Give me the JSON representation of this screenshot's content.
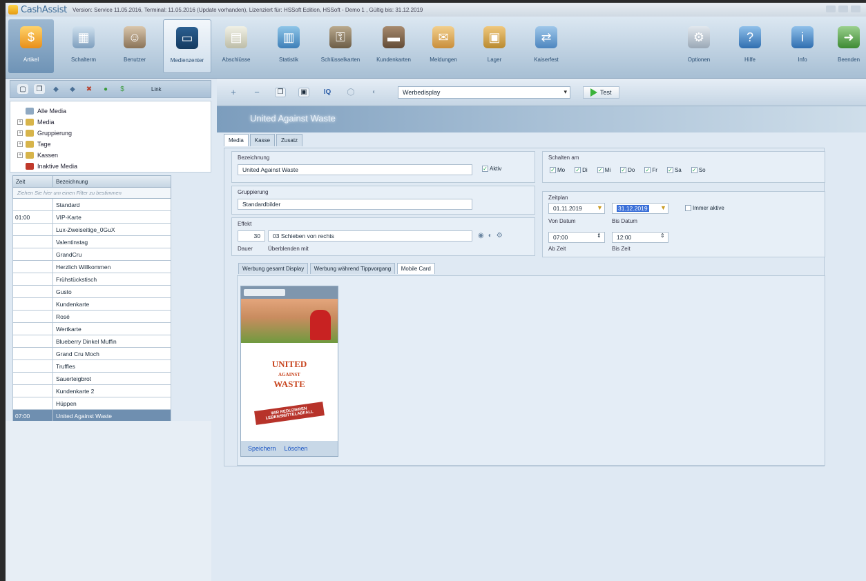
{
  "titlebar": {
    "brand": "CashAssist",
    "version_text": "Version: Service 11.05.2016, Terminal: 11.05.2016 (Update vorhanden), Lizenziert für: HSSoft Edition, HSSoft - Demo 1 , Gültig bis: 31.12.2019"
  },
  "ribbon": {
    "left": [
      {
        "label": "Artikel"
      },
      {
        "label": "Schalterm"
      },
      {
        "label": "Benutzer"
      },
      {
        "label": "Medienzenter"
      }
    ],
    "middle": [
      {
        "label": "Abschlüsse"
      },
      {
        "label": "Statistik"
      },
      {
        "label": "Schlüsselkarten"
      },
      {
        "label": "Kundenkarten"
      },
      {
        "label": "Meldungen"
      },
      {
        "label": "Lager"
      },
      {
        "label": "Kaiserfest"
      }
    ],
    "right": [
      {
        "label": "Optionen"
      },
      {
        "label": "Hilfe"
      },
      {
        "label": "Info"
      },
      {
        "label": "Beenden"
      }
    ]
  },
  "lefttoolbar": {
    "add_label": "Link"
  },
  "tree": [
    {
      "label": "Alle Media",
      "expand": ""
    },
    {
      "label": "Media",
      "expand": "+"
    },
    {
      "label": "Gruppierung",
      "expand": "+"
    },
    {
      "label": "Tage",
      "expand": "+"
    },
    {
      "label": "Kassen",
      "expand": "+"
    },
    {
      "label": "Inaktive Media",
      "expand": ""
    }
  ],
  "grid": {
    "col_time": "Zeit",
    "col_name": "Bezeichnung",
    "filter_placeholder": "Ziehen Sie hier um einen Filter zu bestimmen",
    "rows": [
      {
        "time": "",
        "name": "Standard"
      },
      {
        "time": "01:00",
        "name": "VIP-Karte"
      },
      {
        "time": "",
        "name": "Lux-Zweiseitige_0GuX"
      },
      {
        "time": "",
        "name": "Valentinstag"
      },
      {
        "time": "",
        "name": "GrandCru"
      },
      {
        "time": "",
        "name": "Herzlich Willkommen"
      },
      {
        "time": "",
        "name": "Frühstückstisch"
      },
      {
        "time": "",
        "name": "Gusto"
      },
      {
        "time": "",
        "name": "Kundenkarte"
      },
      {
        "time": "",
        "name": "Rosé"
      },
      {
        "time": "",
        "name": "Wertkarte"
      },
      {
        "time": "",
        "name": "Blueberry Dinkel Muffin"
      },
      {
        "time": "",
        "name": "Grand Cru Moch"
      },
      {
        "time": "",
        "name": "Truffles"
      },
      {
        "time": "",
        "name": "Sauerteigbrot"
      },
      {
        "time": "",
        "name": "Kundenkarte 2"
      },
      {
        "time": "",
        "name": "Hüppen"
      },
      {
        "time": "07:00",
        "name": "United Against Waste"
      }
    ]
  },
  "toolbar": {
    "select_value": "Werbedisplay",
    "test_label": "Test"
  },
  "header": {
    "title": "United Against Waste"
  },
  "tabs": [
    "Media",
    "Kasse",
    "Zusatz"
  ],
  "form": {
    "bezeichnung_label": "Bezeichnung",
    "bezeichnung_value": "United Against Waste",
    "aktiv_label": "Aktiv",
    "gruppierung_label": "Gruppierung",
    "gruppierung_value": "Standardbilder",
    "effekt_label": "Effekt",
    "effekt_num": "30",
    "effekt_value": "03 Schieben von rechts",
    "dauer_label": "Dauer",
    "ueberblend_label": "Überblenden mit",
    "schalten_label": "Schalten am",
    "days": [
      "Mo",
      "Di",
      "Mi",
      "Do",
      "Fr",
      "Sa",
      "So"
    ],
    "zeitplan_label": "Zeitplan",
    "von_datum": "01.11.2019",
    "bis_datum": "31.12.2019",
    "immer_label": "Immer aktive",
    "von_datum_label": "Von Datum",
    "bis_datum_label": "Bis Datum",
    "ab_zeit": "07:00",
    "bis_zeit": "12:00",
    "ab_zeit_label": "Ab Zeit",
    "bis_zeit_label": "Bis Zeit"
  },
  "subtabs": [
    "Werbung gesamt Display",
    "Werbung während Tippvorgang",
    "Mobile Card"
  ],
  "preview": {
    "logo_line1": "UNITED",
    "logo_line2": "AGAINST",
    "logo_line3": "WASTE",
    "stamp_line1": "WIR REDUZIEREN",
    "stamp_line2": "LEBENSMITTELABFALL",
    "save_label": "Speichern",
    "delete_label": "Löschen"
  }
}
